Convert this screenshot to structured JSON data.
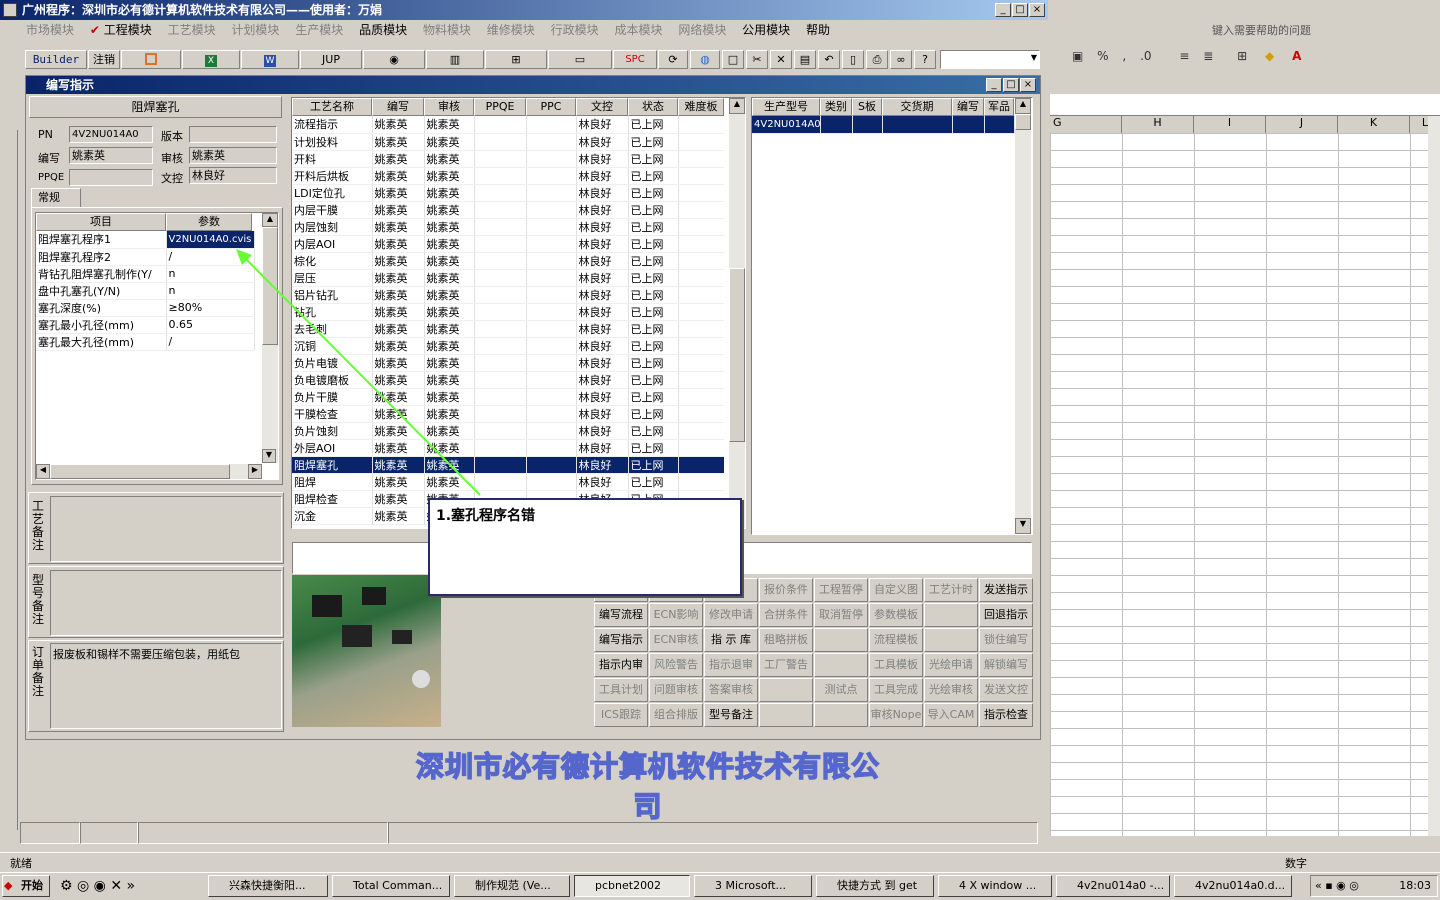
{
  "app": {
    "title": "广州程序：深圳市必有德计算机软件技术有限公司——使用者：万娟"
  },
  "menu": [
    "市场模块",
    "工程模块",
    "工艺模块",
    "计划模块",
    "生产模块",
    "品质模块",
    "物料模块",
    "维修模块",
    "行政模块",
    "成本模块",
    "网络模块",
    "公用模块",
    "帮助"
  ],
  "toolbar": {
    "builder": "Builder",
    "logout": "注销",
    "jup": "JUP",
    "spc": "SPC"
  },
  "excel": {
    "help_placeholder": "键入需要帮助的问题",
    "cols": [
      "G",
      "H",
      "I",
      "J",
      "K",
      "L"
    ],
    "status": "数字"
  },
  "child": {
    "title": "编写指示"
  },
  "left": {
    "section_title": "阻焊塞孔",
    "pn_label": "PN",
    "pn_value": "4V2NU014A0",
    "version_label": "版本",
    "version_value": "",
    "editor_label": "编写",
    "editor_value": "姚素英",
    "reviewer_label": "审核",
    "reviewer_value": "姚素英",
    "ppqe_label": "PPQE",
    "ppqe_value": "",
    "doc_label": "文控",
    "doc_value": "林良好",
    "tab_general": "常规",
    "param_header_item": "项目",
    "param_header_value": "参数",
    "params": [
      {
        "item": "阻焊塞孔程序1",
        "value": "V2NU014A0.cvis"
      },
      {
        "item": "阻焊塞孔程序2",
        "value": "/"
      },
      {
        "item": "背钻孔阻焊塞孔制作(Y/",
        "value": "n"
      },
      {
        "item": "盘中孔塞孔(Y/N)",
        "value": "n"
      },
      {
        "item": "塞孔深度(%)",
        "value": "≥80%"
      },
      {
        "item": "塞孔最小孔径(mm)",
        "value": "0.65"
      },
      {
        "item": "塞孔最大孔径(mm)",
        "value": "/"
      }
    ],
    "process_note_label": "工艺备注",
    "model_note_label": "型号备注",
    "order_note_label": "订单备注",
    "order_note": "报废板和锡样不需要压缩包装，用纸包"
  },
  "process": {
    "headers": [
      "工艺名称",
      "编写",
      "审核",
      "PPQE",
      "PPC",
      "文控",
      "状态",
      "难度板"
    ],
    "rows": [
      [
        "流程指示",
        "姚素英",
        "姚素英",
        "",
        "",
        "林良好",
        "已上网"
      ],
      [
        "计划投料",
        "姚素英",
        "姚素英",
        "",
        "",
        "林良好",
        "已上网"
      ],
      [
        "开料",
        "姚素英",
        "姚素英",
        "",
        "",
        "林良好",
        "已上网"
      ],
      [
        "开料后烘板",
        "姚素英",
        "姚素英",
        "",
        "",
        "林良好",
        "已上网"
      ],
      [
        "LDI定位孔",
        "姚素英",
        "姚素英",
        "",
        "",
        "林良好",
        "已上网"
      ],
      [
        "内层干膜",
        "姚素英",
        "姚素英",
        "",
        "",
        "林良好",
        "已上网"
      ],
      [
        "内层蚀刻",
        "姚素英",
        "姚素英",
        "",
        "",
        "林良好",
        "已上网"
      ],
      [
        "内层AOI",
        "姚素英",
        "姚素英",
        "",
        "",
        "林良好",
        "已上网"
      ],
      [
        "棕化",
        "姚素英",
        "姚素英",
        "",
        "",
        "林良好",
        "已上网"
      ],
      [
        "层压",
        "姚素英",
        "姚素英",
        "",
        "",
        "林良好",
        "已上网"
      ],
      [
        "铝片钻孔",
        "姚素英",
        "姚素英",
        "",
        "",
        "林良好",
        "已上网"
      ],
      [
        "钻孔",
        "姚素英",
        "姚素英",
        "",
        "",
        "林良好",
        "已上网"
      ],
      [
        "去毛刺",
        "姚素英",
        "姚素英",
        "",
        "",
        "林良好",
        "已上网"
      ],
      [
        "沉铜",
        "姚素英",
        "姚素英",
        "",
        "",
        "林良好",
        "已上网"
      ],
      [
        "负片电镀",
        "姚素英",
        "姚素英",
        "",
        "",
        "林良好",
        "已上网"
      ],
      [
        "负电镀磨板",
        "姚素英",
        "姚素英",
        "",
        "",
        "林良好",
        "已上网"
      ],
      [
        "负片干膜",
        "姚素英",
        "姚素英",
        "",
        "",
        "林良好",
        "已上网"
      ],
      [
        "干膜检查",
        "姚素英",
        "姚素英",
        "",
        "",
        "林良好",
        "已上网"
      ],
      [
        "负片蚀刻",
        "姚素英",
        "姚素英",
        "",
        "",
        "林良好",
        "已上网"
      ],
      [
        "外层AOI",
        "姚素英",
        "姚素英",
        "",
        "",
        "林良好",
        "已上网"
      ],
      [
        "阻焊塞孔",
        "姚素英",
        "姚素英",
        "",
        "",
        "林良好",
        "已上网"
      ],
      [
        "阻焊",
        "姚素英",
        "姚素英",
        "",
        "",
        "林良好",
        "已上网"
      ],
      [
        "阻焊检查",
        "姚素英",
        "姚素英",
        "",
        "",
        "林良好",
        "已上网"
      ],
      [
        "沉金",
        "姚素英",
        "姚素英",
        "",
        "",
        "林良好",
        "已上网"
      ]
    ],
    "selected_index": 20
  },
  "models": {
    "headers": [
      "生产型号",
      "类别",
      "S板",
      "交货期",
      "编写",
      "军品"
    ],
    "rows": [
      [
        "4V2NU014A0",
        "",
        "",
        "",
        "",
        ""
      ]
    ]
  },
  "callout": {
    "text": "1.塞孔程序名错"
  },
  "buttons": [
    [
      "",
      "",
      "",
      "报价条件",
      "工程暂停",
      "自定义图",
      "工艺计时",
      "发送指示"
    ],
    [
      "编写流程",
      "ECN影响",
      "修改申请",
      "合拼条件",
      "取消暂停",
      "参数模板",
      "",
      "回退指示"
    ],
    [
      "编写指示",
      "ECN审核",
      "指 示 库",
      "租略拼板",
      "",
      "流程模板",
      "",
      "锁住编写"
    ],
    [
      "指示内审",
      "风险警告",
      "指示退审",
      "工厂警告",
      "",
      "工具模板",
      "光绘申请",
      "解锁编写"
    ],
    [
      "工具计划",
      "问题审核",
      "答案审核",
      "",
      "测试点",
      "工具完成",
      "光绘审核",
      "发送文控"
    ],
    [
      "ICS跟踪",
      "组合排版",
      "型号备注",
      "",
      "",
      "审核Nope",
      "导入CAM",
      "指示检查"
    ]
  ],
  "buttons_enabled": [
    "编写流程",
    "编写指示",
    "指示内审",
    "型号备注",
    "发送指示",
    "回退指示",
    "指 示 库",
    "指示检查"
  ],
  "banner": {
    "company": "深圳市必有德计算机软件技术有限公司"
  },
  "status": {
    "left": "就绪"
  },
  "taskbar": {
    "start": "开始",
    "items": [
      "兴森快捷衡阳...",
      "Total Comman...",
      "制作规范 (Ve...",
      "pcbnet2002",
      "3 Microsoft...",
      "快捷方式 到 get",
      "4 X window ...",
      "4v2nu014a0 -...",
      "4v2nu014a0.d..."
    ],
    "clock": "18:03"
  },
  "colors": {
    "accent": "#0a246a",
    "selection": "#0a246a",
    "arrow": "#66ff33",
    "banner": "#5566cc"
  }
}
